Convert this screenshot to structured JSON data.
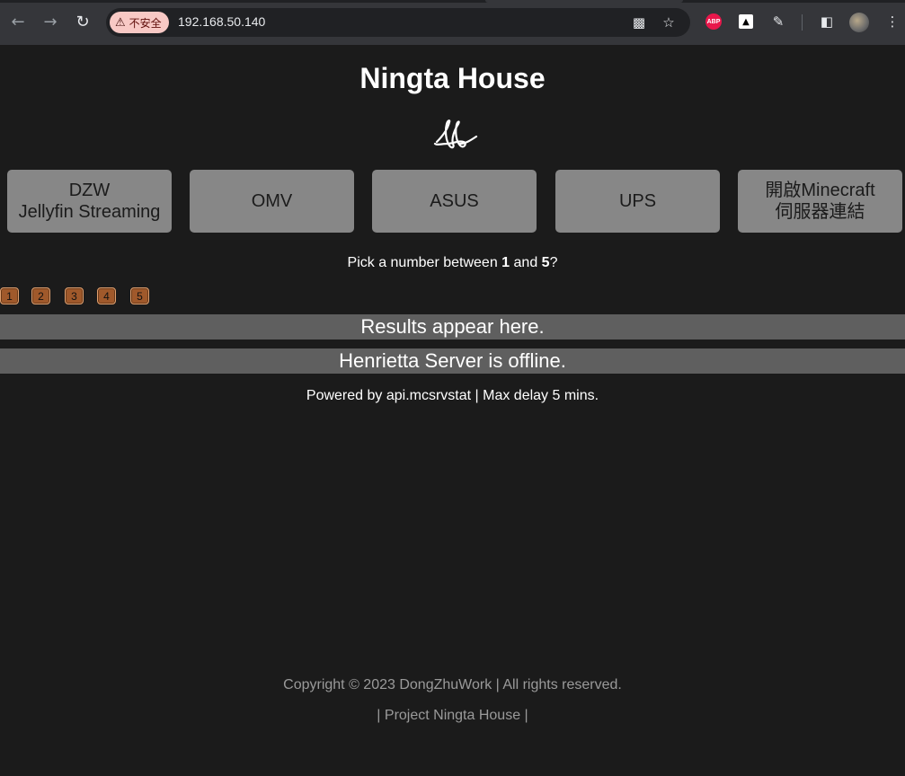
{
  "browser": {
    "security_label": "不安全",
    "url": "192.168.50.140",
    "icons": {
      "back": "arrow-left-icon",
      "forward": "arrow-right-icon",
      "reload": "reload-icon",
      "translate": "translate-icon",
      "bookmark": "star-icon",
      "adblock": "abp-icon",
      "ext2": "extension-icon",
      "extensions": "puzzle-icon",
      "sidepanel": "side-panel-icon",
      "menu": "kebab-menu-icon"
    },
    "abp_text": "ABP"
  },
  "page": {
    "title": "Ningta House",
    "tiles": [
      {
        "label": "DZW\nJellyfin Streaming"
      },
      {
        "label": "OMV"
      },
      {
        "label": "ASUS"
      },
      {
        "label": "UPS"
      },
      {
        "label": "開啟Minecraft\n伺服器連結"
      }
    ],
    "question": {
      "prefix": "Pick a number between ",
      "low": "1",
      "mid": " and ",
      "high": "5",
      "suffix": "?"
    },
    "numbers": [
      "1",
      "2",
      "3",
      "4",
      "5"
    ],
    "results_text": "Results appear here.",
    "server_status": "Henrietta Server is offline.",
    "powered_by": "Powered by api.mcsrvstat | Max delay 5 mins.",
    "copyright": "Copyright © 2023 DongZhuWork | All rights reserved.",
    "project": "| Project Ningta House |"
  },
  "colors": {
    "background": "#1b1b1b",
    "tile": "#878787",
    "bar": "#5f5f5f",
    "number_button": "#a0592b"
  }
}
